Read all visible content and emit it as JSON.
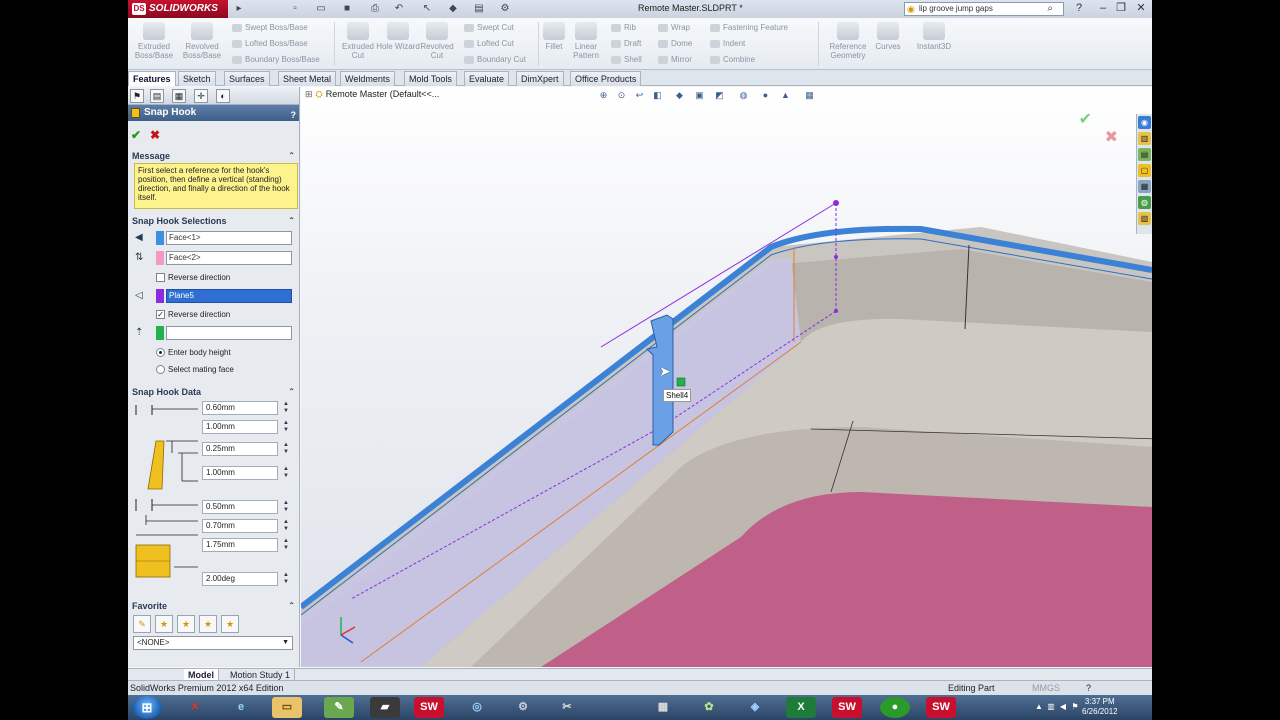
{
  "titlebar": {
    "brand": "SOLIDWORKS",
    "document_title": "Remote Master.SLDPRT *",
    "search_text": "lip groove jump gaps"
  },
  "ribbon": {
    "extruded_boss": "Extruded Boss/Base",
    "revolved_boss": "Revolved Boss/Base",
    "swept_boss": "Swept Boss/Base",
    "lofted_boss": "Lofted Boss/Base",
    "boundary_boss": "Boundary Boss/Base",
    "extruded_cut": "Extruded Cut",
    "hole_wizard": "Hole Wizard",
    "revolved_cut": "Revolved Cut",
    "swept_cut": "Swept Cut",
    "lofted_cut": "Lofted Cut",
    "boundary_cut": "Boundary Cut",
    "fillet": "Fillet",
    "linear_pattern": "Linear Pattern",
    "rib": "Rib",
    "draft": "Draft",
    "shell": "Shell",
    "wrap": "Wrap",
    "dome": "Dome",
    "mirror": "Mirror",
    "fastening_feature": "Fastening Feature",
    "indent": "Indent",
    "combine": "Combine",
    "reference_geometry": "Reference Geometry",
    "curves": "Curves",
    "instant3d": "Instant3D"
  },
  "tabs": [
    "Features",
    "Sketch",
    "Surfaces",
    "Sheet Metal",
    "Weldments",
    "Mold Tools",
    "Evaluate",
    "DimXpert",
    "Office Products"
  ],
  "pm": {
    "title": "Snap Hook",
    "help": "?",
    "message_header": "Message",
    "message_text": "First select a reference for the hook's position, then define a vertical (standing) direction, and finally a direction of the hook itself.",
    "selections_header": "Snap Hook Selections",
    "face1": "Face<1>",
    "face2": "Face<2>",
    "reverse_direction_1": "Reverse direction",
    "plane": "Plane5",
    "reverse_direction_2": "Reverse direction",
    "enter_body_height": "Enter body height",
    "select_mating_face": "Select mating face",
    "data_header": "Snap Hook Data",
    "dims": [
      "0.60mm",
      "1.00mm",
      "0.25mm",
      "1.00mm",
      "0.50mm",
      "0.70mm",
      "1.75mm",
      "2.00deg"
    ],
    "favorite_header": "Favorite",
    "favorite_value": "<NONE>"
  },
  "viewport": {
    "tree_title": "Remote Master  (Default<<...",
    "tooltip": "Shell4"
  },
  "bottom_tabs": [
    "Model",
    "Motion Study 1"
  ],
  "status": {
    "edition": "SolidWorks Premium 2012 x64 Edition",
    "mode": "Editing Part",
    "units": "MMGS"
  },
  "taskbar": {
    "time": "3:37 PM",
    "date": "6/26/2012"
  },
  "colors": {
    "face1_swatch": "#3d8fe0",
    "face2_swatch": "#f29ac6",
    "plane_swatch": "#8a2be2",
    "height_swatch": "#22b14c",
    "model_blue": "#3b82d6",
    "pink_face": "#c06088"
  }
}
